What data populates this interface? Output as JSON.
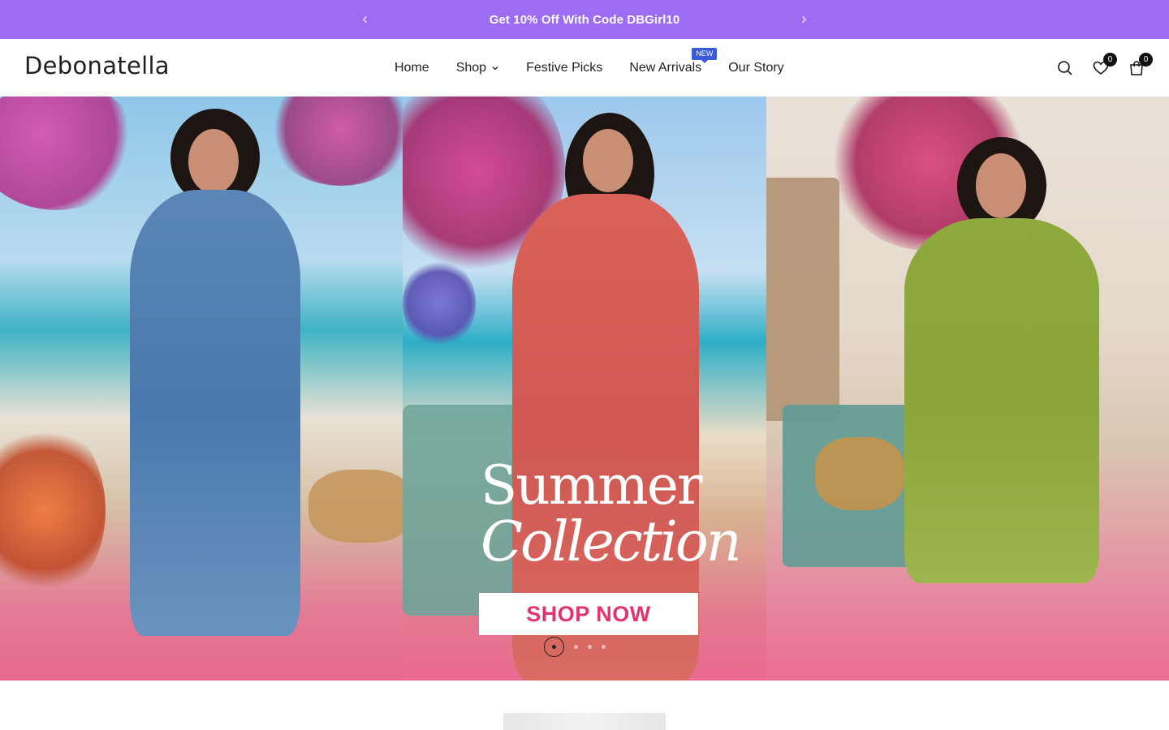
{
  "announcement": {
    "text": "Get 10% Off With Code DBGirl10",
    "background": "#9c6cf2"
  },
  "header": {
    "logo": "Debonatella",
    "nav": [
      {
        "label": "Home"
      },
      {
        "label": "Shop",
        "has_dropdown": true
      },
      {
        "label": "Festive Picks"
      },
      {
        "label": "New Arrivals",
        "badge": "NEW"
      },
      {
        "label": "Our Story"
      }
    ],
    "wishlist_count": "0",
    "cart_count": "0",
    "icons": [
      "search-icon",
      "heart-icon",
      "bag-icon"
    ]
  },
  "hero": {
    "title_line1": "Summer",
    "title_line2": "Collection",
    "cta_label": "SHOP NOW",
    "cta_color": "#e4346f",
    "slide_count": 4,
    "active_slide": 1
  }
}
